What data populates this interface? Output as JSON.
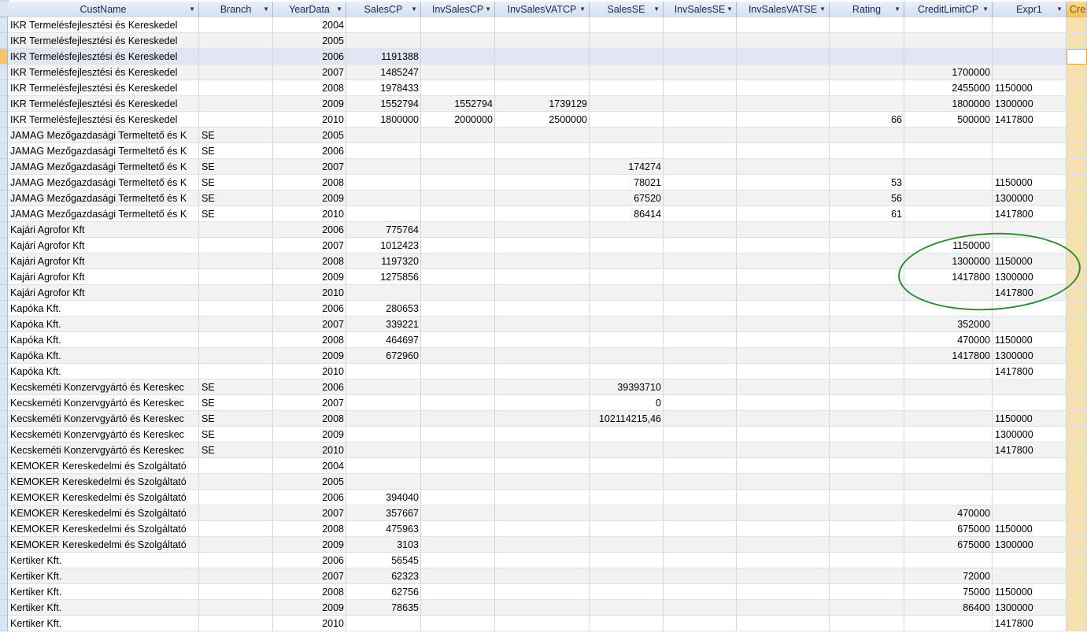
{
  "columns": [
    "CustName",
    "Branch",
    "YearData",
    "SalesCP",
    "InvSalesCP",
    "InvSalesVATCP",
    "SalesSE",
    "InvSalesSE",
    "InvSalesVATSE",
    "Rating",
    "CreditLimitCP",
    "Expr1",
    "Cre"
  ],
  "colors": {
    "header_bg": "#dbe6f5",
    "selected_row_bg": "#e1e6f3",
    "annotation_ellipse": "#2f8a2f"
  },
  "rows": [
    [
      "IKR Termelésfejlesztési és Kereskedel",
      "",
      "2004",
      "",
      "",
      "",
      "",
      "",
      "",
      "",
      "",
      "",
      ""
    ],
    [
      "IKR Termelésfejlesztési és Kereskedel",
      "",
      "2005",
      "",
      "",
      "",
      "",
      "",
      "",
      "",
      "",
      "",
      ""
    ],
    [
      "IKR Termelésfejlesztési és Kereskedel",
      "",
      "2006",
      "1191388",
      "",
      "",
      "",
      "",
      "",
      "",
      "",
      "",
      ""
    ],
    [
      "IKR Termelésfejlesztési és Kereskedel",
      "",
      "2007",
      "1485247",
      "",
      "",
      "",
      "",
      "",
      "",
      "1700000",
      "",
      ""
    ],
    [
      "IKR Termelésfejlesztési és Kereskedel",
      "",
      "2008",
      "1978433",
      "",
      "",
      "",
      "",
      "",
      "",
      "2455000",
      "1150000",
      ""
    ],
    [
      "IKR Termelésfejlesztési és Kereskedel",
      "",
      "2009",
      "1552794",
      "1552794",
      "1739129",
      "",
      "",
      "",
      "",
      "1800000",
      "1300000",
      ""
    ],
    [
      "IKR Termelésfejlesztési és Kereskedel",
      "",
      "2010",
      "1800000",
      "2000000",
      "2500000",
      "",
      "",
      "",
      "66",
      "500000",
      "1417800",
      ""
    ],
    [
      "JAMAG Mezőgazdasági Termeltető és K",
      "SE",
      "2005",
      "",
      "",
      "",
      "",
      "",
      "",
      "",
      "",
      "",
      ""
    ],
    [
      "JAMAG Mezőgazdasági Termeltető és K",
      "SE",
      "2006",
      "",
      "",
      "",
      "",
      "",
      "",
      "",
      "",
      "",
      ""
    ],
    [
      "JAMAG Mezőgazdasági Termeltető és K",
      "SE",
      "2007",
      "",
      "",
      "",
      "174274",
      "",
      "",
      "",
      "",
      "",
      ""
    ],
    [
      "JAMAG Mezőgazdasági Termeltető és K",
      "SE",
      "2008",
      "",
      "",
      "",
      "78021",
      "",
      "",
      "53",
      "",
      "1150000",
      ""
    ],
    [
      "JAMAG Mezőgazdasági Termeltető és K",
      "SE",
      "2009",
      "",
      "",
      "",
      "67520",
      "",
      "",
      "56",
      "",
      "1300000",
      ""
    ],
    [
      "JAMAG Mezőgazdasági Termeltető és K",
      "SE",
      "2010",
      "",
      "",
      "",
      "86414",
      "",
      "",
      "61",
      "",
      "1417800",
      ""
    ],
    [
      "Kajári  Agrofor Kft",
      "",
      "2006",
      "775764",
      "",
      "",
      "",
      "",
      "",
      "",
      "",
      "",
      ""
    ],
    [
      "Kajári  Agrofor Kft",
      "",
      "2007",
      "1012423",
      "",
      "",
      "",
      "",
      "",
      "",
      "1150000",
      "",
      ""
    ],
    [
      "Kajári  Agrofor Kft",
      "",
      "2008",
      "1197320",
      "",
      "",
      "",
      "",
      "",
      "",
      "1300000",
      "1150000",
      ""
    ],
    [
      "Kajári  Agrofor Kft",
      "",
      "2009",
      "1275856",
      "",
      "",
      "",
      "",
      "",
      "",
      "1417800",
      "1300000",
      ""
    ],
    [
      "Kajári  Agrofor Kft",
      "",
      "2010",
      "",
      "",
      "",
      "",
      "",
      "",
      "",
      "",
      "1417800",
      ""
    ],
    [
      "Kapóka Kft.",
      "",
      "2006",
      "280653",
      "",
      "",
      "",
      "",
      "",
      "",
      "",
      "",
      ""
    ],
    [
      "Kapóka Kft.",
      "",
      "2007",
      "339221",
      "",
      "",
      "",
      "",
      "",
      "",
      "352000",
      "",
      ""
    ],
    [
      "Kapóka Kft.",
      "",
      "2008",
      "464697",
      "",
      "",
      "",
      "",
      "",
      "",
      "470000",
      "1150000",
      ""
    ],
    [
      "Kapóka Kft.",
      "",
      "2009",
      "672960",
      "",
      "",
      "",
      "",
      "",
      "",
      "1417800",
      "1300000",
      ""
    ],
    [
      "Kapóka Kft.",
      "",
      "2010",
      "",
      "",
      "",
      "",
      "",
      "",
      "",
      "",
      "1417800",
      ""
    ],
    [
      "Kecskeméti Konzervgyártó és Kereskec",
      "SE",
      "2006",
      "",
      "",
      "",
      "39393710",
      "",
      "",
      "",
      "",
      "",
      ""
    ],
    [
      "Kecskeméti Konzervgyártó és Kereskec",
      "SE",
      "2007",
      "",
      "",
      "",
      "0",
      "",
      "",
      "",
      "",
      "",
      ""
    ],
    [
      "Kecskeméti Konzervgyártó és Kereskec",
      "SE",
      "2008",
      "",
      "",
      "",
      "102114215,46",
      "",
      "",
      "",
      "",
      "1150000",
      ""
    ],
    [
      "Kecskeméti Konzervgyártó és Kereskec",
      "SE",
      "2009",
      "",
      "",
      "",
      "",
      "",
      "",
      "",
      "",
      "1300000",
      ""
    ],
    [
      "Kecskeméti Konzervgyártó és Kereskec",
      "SE",
      "2010",
      "",
      "",
      "",
      "",
      "",
      "",
      "",
      "",
      "1417800",
      ""
    ],
    [
      "KEMOKER Kereskedelmi és Szolgáltató",
      "",
      "2004",
      "",
      "",
      "",
      "",
      "",
      "",
      "",
      "",
      "",
      ""
    ],
    [
      "KEMOKER Kereskedelmi és Szolgáltató",
      "",
      "2005",
      "",
      "",
      "",
      "",
      "",
      "",
      "",
      "",
      "",
      ""
    ],
    [
      "KEMOKER Kereskedelmi és Szolgáltató",
      "",
      "2006",
      "394040",
      "",
      "",
      "",
      "",
      "",
      "",
      "",
      "",
      ""
    ],
    [
      "KEMOKER Kereskedelmi és Szolgáltató",
      "",
      "2007",
      "357667",
      "",
      "",
      "",
      "",
      "",
      "",
      "470000",
      "",
      ""
    ],
    [
      "KEMOKER Kereskedelmi és Szolgáltató",
      "",
      "2008",
      "475963",
      "",
      "",
      "",
      "",
      "",
      "",
      "675000",
      "1150000",
      ""
    ],
    [
      "KEMOKER Kereskedelmi és Szolgáltató",
      "",
      "2009",
      "3103",
      "",
      "",
      "",
      "",
      "",
      "",
      "675000",
      "1300000",
      ""
    ],
    [
      "Kertiker Kft.",
      "",
      "2006",
      "56545",
      "",
      "",
      "",
      "",
      "",
      "",
      "",
      "",
      ""
    ],
    [
      "Kertiker Kft.",
      "",
      "2007",
      "62323",
      "",
      "",
      "",
      "",
      "",
      "",
      "72000",
      "",
      ""
    ],
    [
      "Kertiker Kft.",
      "",
      "2008",
      "62756",
      "",
      "",
      "",
      "",
      "",
      "",
      "75000",
      "1150000",
      ""
    ],
    [
      "Kertiker Kft.",
      "",
      "2009",
      "78635",
      "",
      "",
      "",
      "",
      "",
      "",
      "86400",
      "1300000",
      ""
    ],
    [
      "Kertiker Kft.",
      "",
      "2010",
      "",
      "",
      "",
      "",
      "",
      "",
      "",
      "",
      "1417800",
      ""
    ]
  ],
  "selected_row_index": 2
}
